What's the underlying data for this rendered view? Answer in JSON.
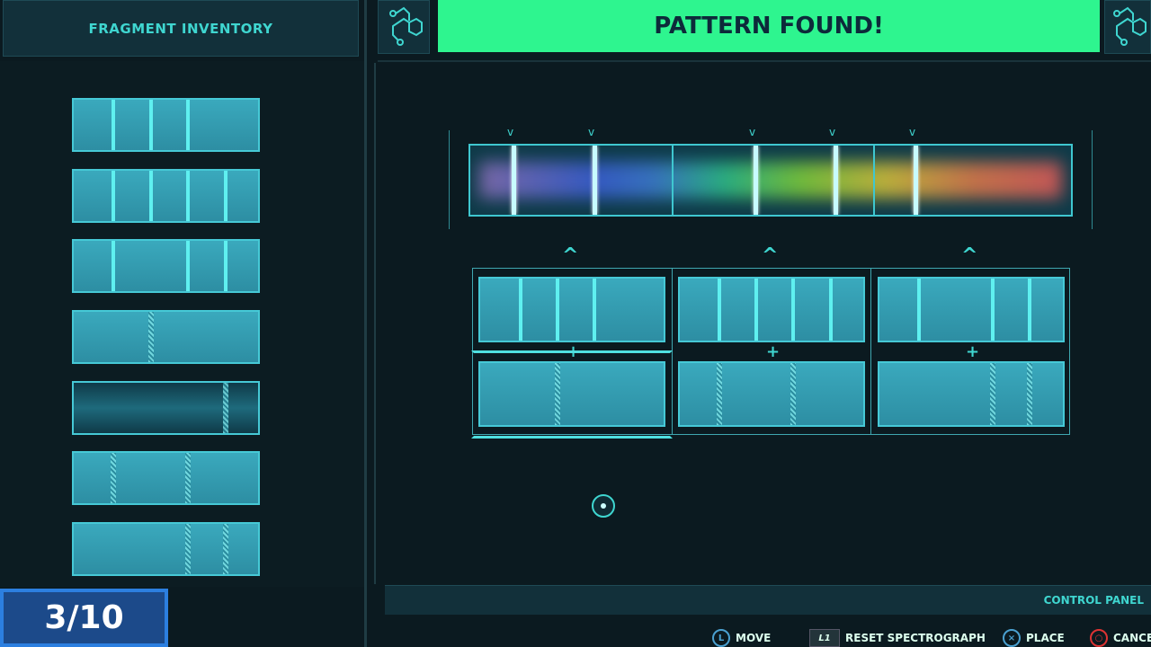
{
  "inventory": {
    "title": "FRAGMENT INVENTORY",
    "fragments": [
      {
        "lines": [
          124,
          166,
          207
        ],
        "hatched": []
      },
      {
        "lines": [
          124,
          166,
          207,
          249
        ],
        "hatched": []
      },
      {
        "lines": [
          124,
          207,
          249
        ],
        "hatched": []
      },
      {
        "lines": [],
        "hatched": [
          166
        ]
      },
      {
        "lines": [],
        "hatched": [
          249
        ],
        "selected": true
      },
      {
        "lines": [],
        "hatched": [
          124,
          207
        ]
      },
      {
        "lines": [],
        "hatched": [
          207,
          249
        ]
      }
    ]
  },
  "banner": {
    "text": "PATTERN FOUND!",
    "color": "#2ef58f"
  },
  "icons": {
    "left": "molecule-icon",
    "right": "molecule-icon"
  },
  "score": {
    "text": "3/10"
  },
  "control_panel": {
    "title": "CONTROL PANEL",
    "hints": [
      {
        "icon": "L",
        "label": "MOVE"
      },
      {
        "icon": "L1",
        "label": "RESET SPECTROGRAPH"
      },
      {
        "icon": "×",
        "label": "PLACE"
      },
      {
        "icon": "○",
        "label": "CANCEL"
      }
    ]
  }
}
